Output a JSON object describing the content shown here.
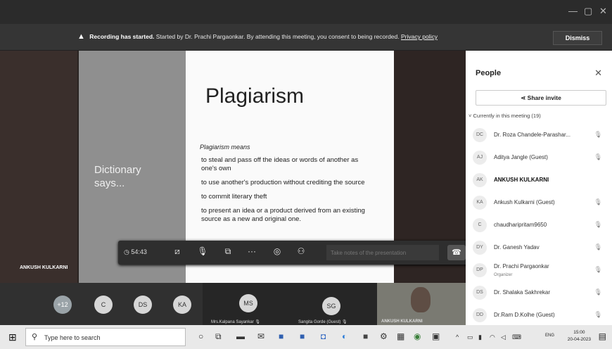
{
  "banner": {
    "title": "Recording has started.",
    "message": "Started by Dr. Prachi Pargaonkar. By attending this meeting, you consent to being recorded.",
    "link": "Privacy policy",
    "dismiss": "Dismiss"
  },
  "slide": {
    "side_text_1": "Dictionary",
    "side_text_2": "says...",
    "title": "Plagiarism",
    "lead": "Plagiarism means",
    "bullets": [
      "to steal and pass off the ideas or words of another as one's own",
      "to use another's production without crediting the source",
      "to commit literary theft",
      "to present an idea or a product derived from an existing source as a new and original one."
    ]
  },
  "presenter": {
    "name": "ANKUSH KULKARNI"
  },
  "toolbar": {
    "timer": "54:43",
    "chat_placeholder": "Take notes of the presentation"
  },
  "strip": {
    "avatars": [
      "+12",
      "C",
      "DS",
      "KA",
      "MS",
      "SG"
    ],
    "ms_label": "Mrs.Kalpana Sayankar",
    "sg_label": "Sangita Gorde (Guest)",
    "video_label": "ANKUSH KULKARNI"
  },
  "people": {
    "title": "People",
    "share": "Share invite",
    "section": "Currently in this meeting (19)",
    "list": [
      {
        "initials": "DC",
        "name": "Dr. Roza Chandele-Parashar...",
        "sub": ""
      },
      {
        "initials": "AJ",
        "name": "Aditya Jangle (Guest)",
        "sub": ""
      },
      {
        "initials": "AK",
        "name": "ANKUSH KULKARNI",
        "sub": ""
      },
      {
        "initials": "KA",
        "name": "Ankush Kulkarni (Guest)",
        "sub": ""
      },
      {
        "initials": "C",
        "name": "chaudharipritam9650",
        "sub": ""
      },
      {
        "initials": "DY",
        "name": "Dr. Ganesh Yadav",
        "sub": ""
      },
      {
        "initials": "DP",
        "name": "Dr. Prachi Pargaonkar",
        "sub": "Organizer"
      },
      {
        "initials": "DS",
        "name": "Dr. Shalaka Sakhrekar",
        "sub": ""
      },
      {
        "initials": "DD",
        "name": "Dr.Ram D.Kolhe (Guest)",
        "sub": ""
      }
    ]
  },
  "taskbar": {
    "search": "Type here to search",
    "lang": "ENG",
    "time": "15:00",
    "date": "20-04-2023"
  }
}
